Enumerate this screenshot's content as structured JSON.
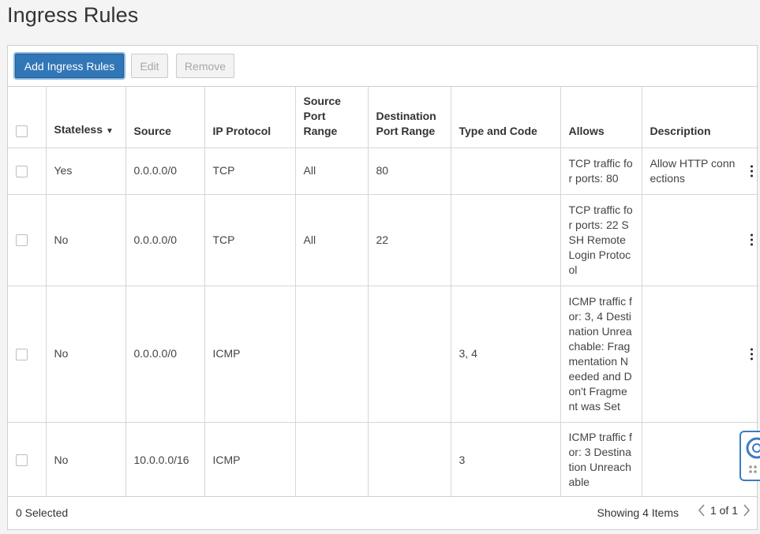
{
  "page_title": "Ingress Rules",
  "toolbar": {
    "add_label": "Add Ingress Rules",
    "edit_label": "Edit",
    "remove_label": "Remove"
  },
  "columns": {
    "stateless": "Stateless",
    "source": "Source",
    "ip_protocol": "IP Protocol",
    "source_port_range": "Source Port Range",
    "destination_port_range": "Destination Port Range",
    "type_and_code": "Type and Code",
    "allows": "Allows",
    "description": "Description"
  },
  "rows": [
    {
      "stateless": "Yes",
      "source": "0.0.0.0/0",
      "ip_protocol": "TCP",
      "source_port_range": "All",
      "destination_port_range": "80",
      "type_and_code": "",
      "allows": "TCP traffic for ports: 80",
      "description": "Allow HTTP connections"
    },
    {
      "stateless": "No",
      "source": "0.0.0.0/0",
      "ip_protocol": "TCP",
      "source_port_range": "All",
      "destination_port_range": "22",
      "type_and_code": "",
      "allows": "TCP traffic for ports: 22 SSH Remote Login Protocol",
      "description": ""
    },
    {
      "stateless": "No",
      "source": "0.0.0.0/0",
      "ip_protocol": "ICMP",
      "source_port_range": "",
      "destination_port_range": "",
      "type_and_code": "3, 4",
      "allows": "ICMP traffic for: 3, 4 Destination Unreachable: Fragmentation Needed and Don't Fragment was Set",
      "description": ""
    },
    {
      "stateless": "No",
      "source": "10.0.0.0/16",
      "ip_protocol": "ICMP",
      "source_port_range": "",
      "destination_port_range": "",
      "type_and_code": "3",
      "allows": "ICMP traffic for: 3 Destination Unreachable",
      "description": ""
    }
  ],
  "footer": {
    "selected": "0 Selected",
    "showing": "Showing 4 Items",
    "page": "1 of 1"
  },
  "icons": {
    "sort": "caret-down-icon",
    "row_actions": "kebab-menu-icon",
    "prev": "chevron-left-icon",
    "next": "chevron-right-icon",
    "help": "lifebuoy-icon"
  },
  "colors": {
    "primary": "#3176b6",
    "help_border": "#3a7cc4"
  }
}
